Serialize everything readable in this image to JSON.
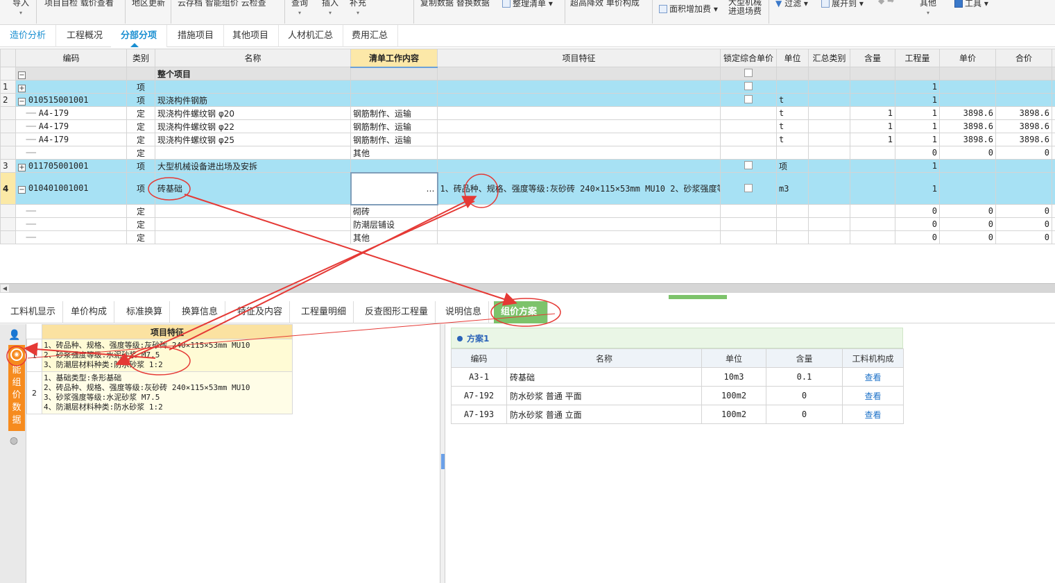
{
  "ribbon": {
    "items": [
      "导入",
      "项目自检  载价查看",
      "地区更新",
      "云存档  智能组价  云检查",
      "查询",
      "插入",
      "补充",
      "复制数据  替换数据",
      "整理清单",
      "超高降效  单价构成",
      "面积增加费",
      "进退场费",
      "过滤",
      "展开到",
      "其他",
      "工具"
    ],
    "extra_top": "大型机械"
  },
  "main_tabs": [
    "造价分析",
    "工程概况",
    "分部分项",
    "措施项目",
    "其他项目",
    "人材机汇总",
    "费用汇总"
  ],
  "grid": {
    "columns": [
      "编码",
      "类别",
      "名称",
      "清单工作内容",
      "项目特征",
      "锁定综合单价",
      "单位",
      "汇总类别",
      "含量",
      "工程量",
      "单价",
      "合价"
    ],
    "rows": [
      {
        "rn": "",
        "expander": "−",
        "code": "",
        "type": "",
        "name": "整个项目",
        "work": "",
        "feat": "",
        "lock": true,
        "unit": "",
        "cat": "",
        "qty": "",
        "amount": "",
        "price": "",
        "total": "",
        "style": "hdr"
      },
      {
        "rn": "1",
        "expander": "+",
        "code": "",
        "type": "项",
        "name": "",
        "work": "",
        "feat": "",
        "lock": true,
        "unit": "",
        "cat": "",
        "qty": "",
        "amount": "1",
        "price": "",
        "total": "",
        "style": "lb"
      },
      {
        "rn": "2",
        "expander": "−",
        "code": "010515001001",
        "type": "项",
        "name": "现浇构件钢筋",
        "work": "",
        "feat": "",
        "lock": true,
        "unit": "t",
        "cat": "",
        "qty": "",
        "amount": "1",
        "price": "",
        "total": "",
        "style": "lb"
      },
      {
        "rn": "",
        "expander": "",
        "code": "A4-179",
        "type": "定",
        "name": "现浇构件螺纹钢 φ20",
        "work": "钢筋制作、运输",
        "feat": "",
        "lock": false,
        "unit": "t",
        "cat": "",
        "qty": "1",
        "amount": "1",
        "price": "3898.6",
        "total": "3898.6",
        "style": ""
      },
      {
        "rn": "",
        "expander": "",
        "code": "A4-179",
        "type": "定",
        "name": "现浇构件螺纹钢 φ22",
        "work": "钢筋制作、运输",
        "feat": "",
        "lock": false,
        "unit": "t",
        "cat": "",
        "qty": "1",
        "amount": "1",
        "price": "3898.6",
        "total": "3898.6",
        "style": ""
      },
      {
        "rn": "",
        "expander": "",
        "code": "A4-179",
        "type": "定",
        "name": "现浇构件螺纹钢 φ25",
        "work": "钢筋制作、运输",
        "feat": "",
        "lock": false,
        "unit": "t",
        "cat": "",
        "qty": "1",
        "amount": "1",
        "price": "3898.6",
        "total": "3898.6",
        "style": ""
      },
      {
        "rn": "",
        "expander": "",
        "code": "",
        "type": "定",
        "name": "",
        "work": "其他",
        "feat": "",
        "lock": false,
        "unit": "",
        "cat": "",
        "qty": "",
        "amount": "0",
        "price": "0",
        "total": "0",
        "style": ""
      },
      {
        "rn": "3",
        "expander": "+",
        "code": "011705001001",
        "type": "项",
        "name": "大型机械设备进出场及安拆",
        "work": "",
        "feat": "",
        "lock": true,
        "unit": "项",
        "cat": "",
        "qty": "",
        "amount": "1",
        "price": "",
        "total": "",
        "style": "lb"
      },
      {
        "rn": "4",
        "expander": "−",
        "code": "010401001001",
        "type": "项",
        "name": "砖基础",
        "work": "…",
        "feat": "1、砖品种、规格、强度等级:灰砂砖 240×115×53mm MU10\n2、砂浆强度等级:水泥砂浆 M7.5\n3、防潮层材料种类:防水砂浆 1:2",
        "lock": true,
        "unit": "m3",
        "cat": "",
        "qty": "",
        "amount": "1",
        "price": "",
        "total": "",
        "style": "sel"
      },
      {
        "rn": "",
        "expander": "",
        "code": "",
        "type": "定",
        "name": "",
        "work": "砌砖",
        "feat": "",
        "lock": false,
        "unit": "",
        "cat": "",
        "qty": "",
        "amount": "0",
        "price": "0",
        "total": "0",
        "style": ""
      },
      {
        "rn": "",
        "expander": "",
        "code": "",
        "type": "定",
        "name": "",
        "work": "防潮层铺设",
        "feat": "",
        "lock": false,
        "unit": "",
        "cat": "",
        "qty": "",
        "amount": "0",
        "price": "0",
        "total": "0",
        "style": ""
      },
      {
        "rn": "",
        "expander": "",
        "code": "",
        "type": "定",
        "name": "",
        "work": "其他",
        "feat": "",
        "lock": false,
        "unit": "",
        "cat": "",
        "qty": "",
        "amount": "0",
        "price": "0",
        "total": "0",
        "style": ""
      }
    ]
  },
  "bottom_tabs": [
    "工料机显示",
    "单价构成",
    "标准换算",
    "换算信息",
    "特征及内容",
    "工程量明细",
    "反查图形工程量",
    "说明信息",
    "组价方案"
  ],
  "side_tab": "智能组价数据",
  "feature_panel": {
    "header": "项目特征",
    "rows": [
      {
        "idx": "1",
        "text": "1、砖品种、规格、强度等级:灰砂砖 240×115×53mm MU10\n2、砂浆强度等级:水泥砂浆 M7.5\n3、防潮层材料种类:防水砂浆 1:2"
      },
      {
        "idx": "2",
        "text": "1、基础类型:条形基础\n2、砖品种、规格、强度等级:灰砂砖 240×115×53mm MU10\n3、砂浆强度等级:水泥砂浆 M7.5\n4、防潮层材料种类:防水砂浆 1:2"
      }
    ]
  },
  "plan": {
    "title": "方案1",
    "columns": [
      "编码",
      "名称",
      "单位",
      "含量",
      "工料机构成"
    ],
    "rows": [
      {
        "code": "A3-1",
        "name": "砖基础",
        "unit": "10m3",
        "qty": "0.1",
        "link": "查看"
      },
      {
        "code": "A7-192",
        "name": "防水砂浆 普通 平面",
        "unit": "100m2",
        "qty": "0",
        "link": "查看"
      },
      {
        "code": "A7-193",
        "name": "防水砂浆 普通 立面",
        "unit": "100m2",
        "qty": "0",
        "link": "查看"
      }
    ]
  },
  "colors": {
    "accent": "#1a8fd1",
    "row_blue": "#a7e1f4",
    "green_tab": "#7dc36b",
    "orange": "#f68b1e",
    "annotation_red": "#e53935"
  }
}
